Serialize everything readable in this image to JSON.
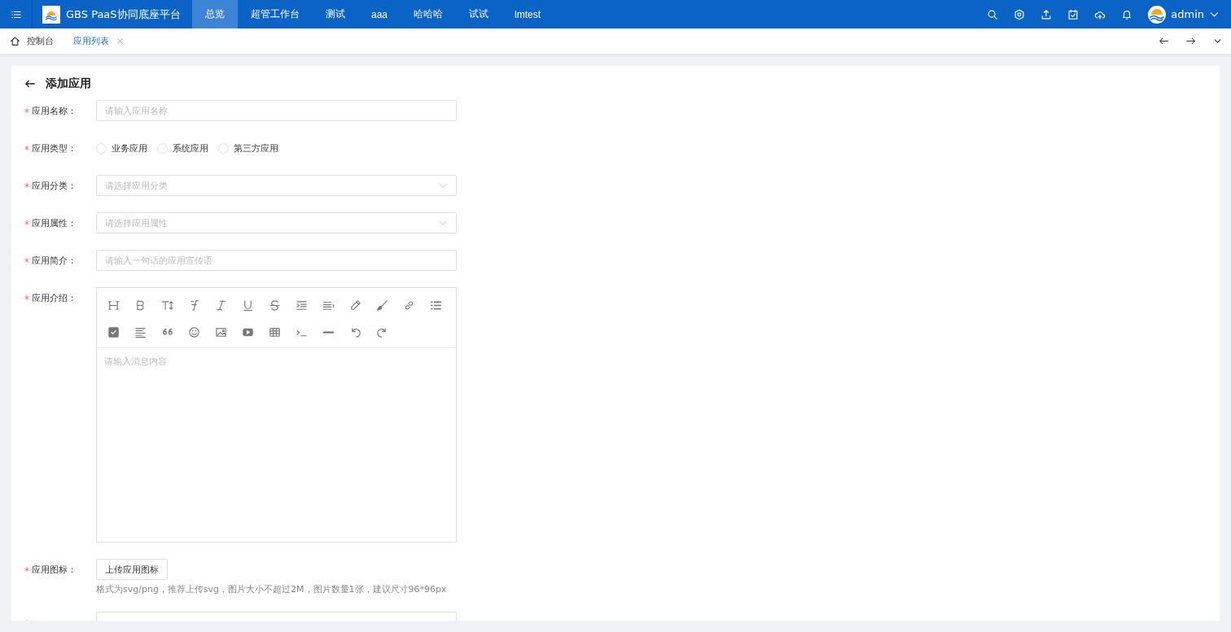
{
  "header": {
    "title": "GBS PaaS协同底座平台",
    "user": "admin",
    "nav": [
      {
        "label": "总览",
        "selected": true
      },
      {
        "label": "超管工作台",
        "selected": false
      },
      {
        "label": "测试",
        "selected": false
      },
      {
        "label": "aaa",
        "selected": false
      },
      {
        "label": "哈哈哈",
        "selected": false
      },
      {
        "label": "试试",
        "selected": false
      },
      {
        "label": "lmtest",
        "selected": false
      }
    ]
  },
  "tabs": [
    {
      "label": "控制台",
      "selected": false,
      "kind": "home"
    },
    {
      "label": "应用列表",
      "selected": true,
      "kind": "closable"
    }
  ],
  "page": {
    "title": "添加应用"
  },
  "form": {
    "fields": [
      {
        "kind": "text",
        "required": true,
        "label": "应用名称：",
        "placeholder": "请输入应用名称"
      },
      {
        "kind": "radio",
        "required": true,
        "label": "应用类型：",
        "options": [
          {
            "label": "业务应用",
            "selected": false
          },
          {
            "label": "系统应用",
            "selected": false
          },
          {
            "label": "第三方应用",
            "selected": false
          }
        ]
      },
      {
        "kind": "select",
        "required": true,
        "label": "应用分类：",
        "placeholder": "请选择应用分类"
      },
      {
        "kind": "select",
        "required": true,
        "label": "应用属性：",
        "placeholder": "请选择应用属性"
      },
      {
        "kind": "text",
        "required": true,
        "label": "应用简介：",
        "placeholder": "请输入一句话的应用宣传语"
      },
      {
        "kind": "editor",
        "required": true,
        "label": "应用介绍：",
        "placeholder": "请输入消息内容"
      },
      {
        "kind": "upload",
        "required": true,
        "label": "应用图标：",
        "button": "上传应用图标",
        "hint": "格式为svg/png，推荐上传svg，图片大小不超过2M，图片数量1张，建议尺寸96*96px"
      },
      {
        "kind": "text",
        "required": true
      }
    ]
  }
}
